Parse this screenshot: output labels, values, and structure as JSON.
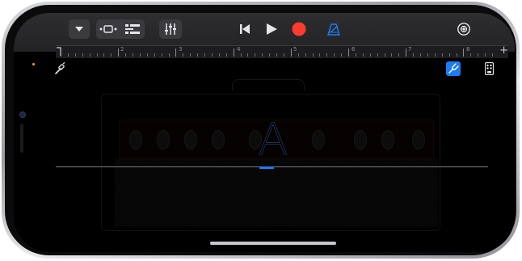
{
  "toolbar": {
    "menu_icon": "chevron-down-icon",
    "view_icons": [
      "browser-view-icon",
      "tracks-view-icon"
    ],
    "mixer_icon": "mixer-sliders-icon",
    "transport": [
      "skip-back-icon",
      "play-icon",
      "record-icon"
    ],
    "metronome_icon": "metronome-icon",
    "settings_icon": "settings-gear-icon",
    "record_color": "#ff3b30",
    "accent_color": "#1c7cf4"
  },
  "ruler": {
    "bar_numbers": [
      "2",
      "3",
      "4",
      "5",
      "6",
      "7",
      "8"
    ],
    "add_label": "+"
  },
  "side_tools": {
    "left_icon": "guitar-cable-icon",
    "tuner_icon": "tuning-fork-icon",
    "stompbox_icon": "stompbox-pedal-icon"
  },
  "tuner": {
    "note": "A"
  }
}
